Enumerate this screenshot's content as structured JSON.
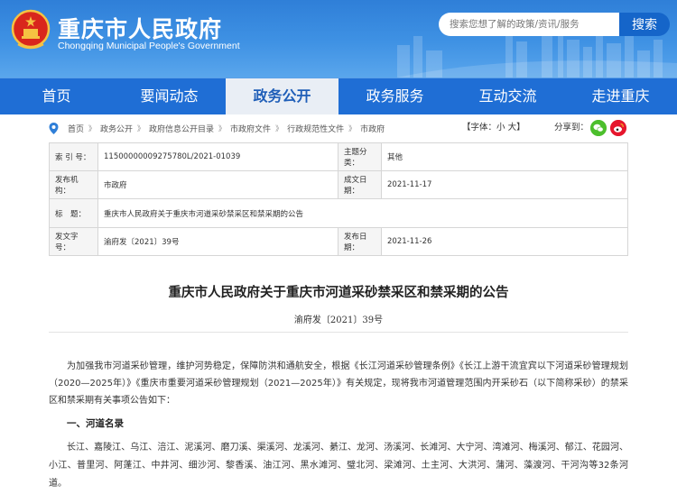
{
  "header": {
    "title": "重庆市人民政府",
    "subtitle": "Chongqing Municipal People's Government",
    "search_placeholder": "搜索您想了解的政策/资讯/服务",
    "search_button": "搜索"
  },
  "nav": {
    "items": [
      {
        "label": "首页"
      },
      {
        "label": "要闻动态"
      },
      {
        "label": "政务公开"
      },
      {
        "label": "政务服务"
      },
      {
        "label": "互动交流"
      },
      {
        "label": "走进重庆"
      }
    ],
    "active_index": 2
  },
  "breadcrumb": {
    "items": [
      "首页",
      "政务公开",
      "政府信息公开目录",
      "市政府文件",
      "行政规范性文件",
      "市政府"
    ],
    "separator": "》",
    "font_label": "【字体：",
    "font_small": "小",
    "font_large": "大",
    "font_close": "】",
    "share_label": "分享到："
  },
  "info": {
    "index_key": "索 引 号：",
    "index_value": "11500000009275780L/2021-01039",
    "topic_key": "主题分类：",
    "topic_value": "其他",
    "issuer_key": "发布机构：",
    "issuer_value": "市政府",
    "date_key": "成文日期：",
    "date_value": "2021-11-17",
    "title_key": "标　题：",
    "title_value": "重庆市人民政府关于重庆市河道采砂禁采区和禁采期的公告",
    "docno_key": "发文字号：",
    "docno_value": "渝府发〔2021〕39号",
    "pubdate_key": "发布日期：",
    "pubdate_value": "2021-11-26"
  },
  "article": {
    "title": "重庆市人民政府关于重庆市河道采砂禁采区和禁采期的公告",
    "doc_no": "渝府发〔2021〕39号",
    "para1": "为加强我市河道采砂管理，维护河势稳定，保障防洪和通航安全，根据《长江河道采砂管理条例》《长江上游干流宜宾以下河道采砂管理规划（2020—2025年）》《重庆市重要河道采砂管理规划（2021—2025年）》有关规定，现将我市河道管理范围内开采砂石（以下简称采砂）的禁采区和禁采期有关事项公告如下：",
    "section1": "一、河道名录",
    "para2": "长江、嘉陵江、乌江、涪江、泥溪河、磨刀溪、渠溪河、龙溪河、綦江、龙河、汤溪河、长滩河、大宁河、湾滩河、梅溪河、郁江、花园河、小江、普里河、阿蓬江、中井河、细沙河、黎香溪、油江河、黑水滩河、璧北河、梁滩河、土主河、大洪河、蒲河、藻渡河、干河沟等32条河道。"
  },
  "colors": {
    "header_blue": "#3f92e4",
    "nav_blue": "#1f6ed5",
    "nav_active_bg": "#e9eef5",
    "search_button": "#1565c9"
  }
}
